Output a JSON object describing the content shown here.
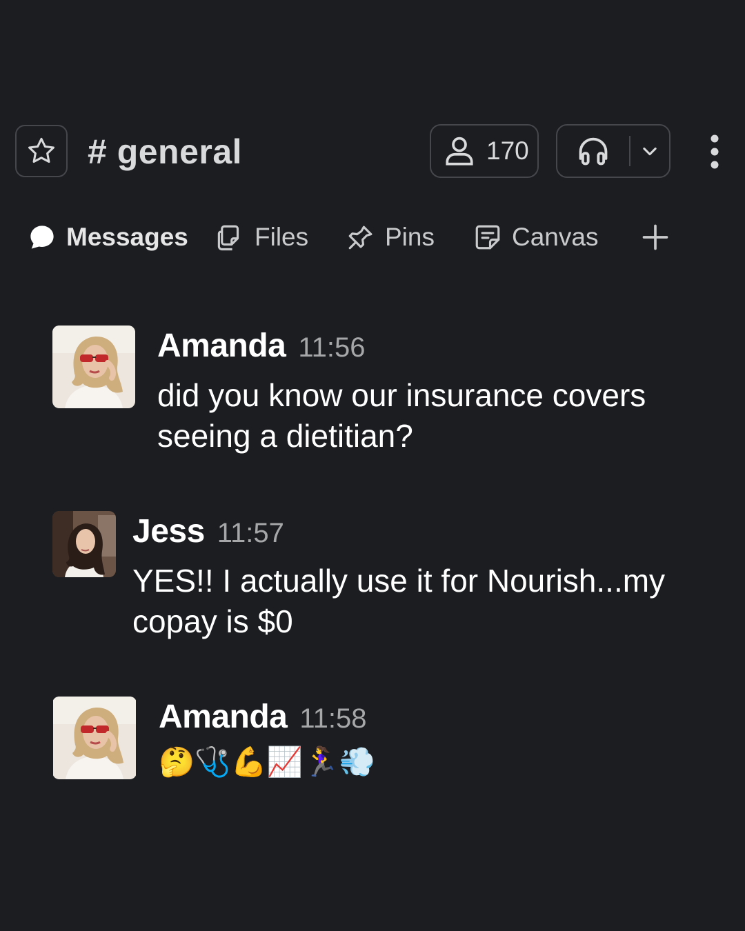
{
  "header": {
    "channel_name": "# general",
    "member_count": "170",
    "icons": [
      "star-icon",
      "person-icon",
      "headphones-icon",
      "chevron-down-icon",
      "kebab-menu-icon"
    ]
  },
  "tabs": [
    {
      "label": "Messages",
      "icon": "chat-bubble-icon",
      "active": true
    },
    {
      "label": "Files",
      "icon": "files-icon",
      "active": false
    },
    {
      "label": "Pins",
      "icon": "pin-icon",
      "active": false
    },
    {
      "label": "Canvas",
      "icon": "canvas-icon",
      "active": false
    }
  ],
  "messages": [
    {
      "author": "Amanda",
      "time": "11:56",
      "text": "did you know our insurance covers seeing a dietitian?"
    },
    {
      "author": "Jess",
      "time": "11:57",
      "text": "YES!! I actually use it for Nourish...my copay is $0"
    },
    {
      "author": "Amanda",
      "time": "11:58",
      "text": "🤔🩺💪📈🏃‍♀️💨"
    }
  ],
  "colors": {
    "background": "#1b1d21",
    "border": "#45474c",
    "text": "#ffffff",
    "muted": "#a6a7a9"
  }
}
